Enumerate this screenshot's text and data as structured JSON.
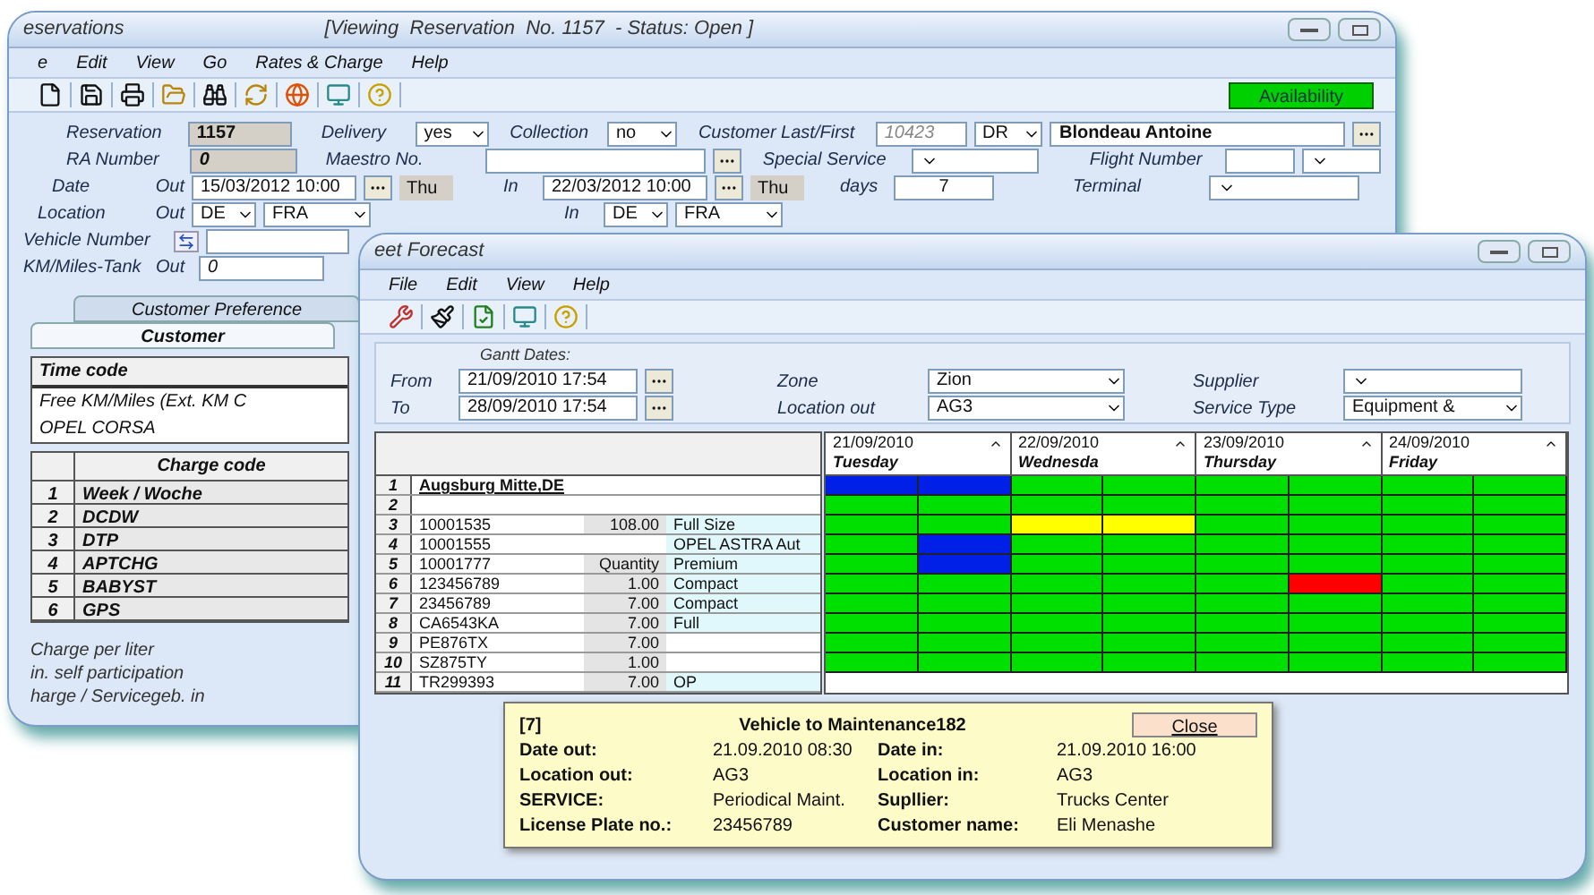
{
  "reservation_window": {
    "title": "eservations",
    "status": "[Viewing  Reservation  No. 1157  - Status: Open ]",
    "menu": [
      "e",
      "Edit",
      "View",
      "Go",
      "Rates & Charge",
      "Help"
    ],
    "availability_button": "Availability",
    "form": {
      "reservation": {
        "label": "Reservation",
        "value": "1157"
      },
      "delivery": {
        "label": "Delivery",
        "value": "yes"
      },
      "collection": {
        "label": "Collection",
        "value": "no"
      },
      "customer": {
        "label": "Customer Last/First",
        "id": "10423",
        "title": "DR",
        "name": "Blondeau Antoine"
      },
      "ra_number": {
        "label": "RA Number",
        "value": "0"
      },
      "maestro": {
        "label": "Maestro No."
      },
      "special_service": {
        "label": "Special Service"
      },
      "flight_number": {
        "label": "Flight Number"
      },
      "date": {
        "label": "Date",
        "out_label": "Out",
        "out_value": "15/03/2012 10:00",
        "out_day": "Thu",
        "in_label": "In",
        "in_value": "22/03/2012 10:00",
        "in_day": "Thu",
        "days_label": "days",
        "days_value": "7"
      },
      "terminal": {
        "label": "Terminal"
      },
      "location": {
        "label": "Location",
        "out_label": "Out",
        "out_country": "DE",
        "out_station": "FRA",
        "in_label": "In",
        "in_country": "DE",
        "in_station": "FRA"
      },
      "vehicle_number": {
        "label": "Vehicle Number"
      },
      "km_tank": {
        "label": "KM/Miles-Tank",
        "out_label": "Out",
        "out_value": "0"
      }
    },
    "tabs": [
      {
        "label": "Customer Preference",
        "selected": false
      },
      {
        "label": "Customer",
        "selected": true
      }
    ],
    "time_code_table": {
      "header": "Time code",
      "rows": [
        "Free KM/Miles (Ext. KM C",
        "OPEL CORSA"
      ]
    },
    "charge_code_table": {
      "header": "Charge code",
      "rows": [
        {
          "no": "1",
          "code": "Week / Woche"
        },
        {
          "no": "2",
          "code": "DCDW"
        },
        {
          "no": "3",
          "code": "DTP"
        },
        {
          "no": "4",
          "code": "APTCHG"
        },
        {
          "no": "5",
          "code": "BABYST"
        },
        {
          "no": "6",
          "code": "GPS"
        }
      ]
    },
    "footer_labels": [
      "Charge per liter",
      "in. self participation",
      "harge / Servicegeb. in"
    ]
  },
  "forecast_window": {
    "title": "eet Forecast",
    "menu": [
      "File",
      "Edit",
      "View",
      "Help"
    ],
    "filters": {
      "gantt_dates_label": "Gantt Dates:",
      "from": {
        "label": "From",
        "value": "21/09/2010 17:54"
      },
      "to": {
        "label": "To",
        "value": "28/09/2010 17:54"
      },
      "zone": {
        "label": "Zone",
        "value": "Zion"
      },
      "location_out": {
        "label": "Location out",
        "value": "AG3"
      },
      "supplier": {
        "label": "Supplier"
      },
      "service_type": {
        "label": "Service Type",
        "value": "Equipment &"
      }
    },
    "vehicle_table": {
      "rows": [
        {
          "no": "1",
          "column_1": "Augsburg Mitte,DE"
        },
        {
          "no": "2"
        },
        {
          "no": "3",
          "column_1": "10001535",
          "column_2": "108.00",
          "column_3": "Full Size"
        },
        {
          "no": "4",
          "column_1": "10001555",
          "column_3": "OPEL ASTRA Aut"
        },
        {
          "no": "5",
          "column_1": "10001777",
          "column_2": "Quantity",
          "column_3": "Premium"
        },
        {
          "no": "6",
          "column_1": "123456789",
          "column_2": "1.00",
          "column_3": "Compact"
        },
        {
          "no": "7",
          "column_1": "23456789",
          "column_2": "7.00",
          "column_3": "Compact"
        },
        {
          "no": "8",
          "column_1": "CA6543KA",
          "column_2": "7.00",
          "column_3": "Full"
        },
        {
          "no": "9",
          "column_1": "PE876TX",
          "column_2": "7.00"
        },
        {
          "no": "10",
          "column_1": "SZ875TY",
          "column_2": "1.00"
        },
        {
          "no": "11",
          "column_1": "TR299393",
          "column_2": "7.00",
          "column_3": "OP"
        }
      ]
    },
    "gantt": {
      "days": [
        {
          "date": "21/09/2010",
          "weekday": "Tuesday"
        },
        {
          "date": "22/09/2010",
          "weekday": "Wednesda"
        },
        {
          "date": "23/09/2010",
          "weekday": "Thursday"
        },
        {
          "date": "24/09/2010",
          "weekday": "Friday"
        }
      ],
      "rows": [
        {
          "cells": [
            {
              "color": "#0020e8"
            },
            {
              "color": "#0020e8"
            },
            {
              "color": "#00e000"
            },
            {
              "color": "#00e000"
            },
            {
              "color": "#00e000"
            },
            {
              "color": "#00e000"
            },
            {
              "color": "#00e000"
            },
            {
              "color": "#00e000"
            }
          ]
        },
        {
          "cells": [
            {
              "color": "#00e000"
            },
            {
              "color": "#00e000"
            },
            {
              "color": "#00e000"
            },
            {
              "color": "#00e000"
            },
            {
              "color": "#00e000"
            },
            {
              "color": "#00e000"
            },
            {
              "color": "#00e000"
            },
            {
              "color": "#00e000"
            }
          ]
        },
        {
          "cells": [
            {
              "color": "#00e000"
            },
            {
              "color": "#00e000"
            },
            {
              "color": "#ffff00"
            },
            {
              "color": "#ffff00"
            },
            {
              "color": "#00e000"
            },
            {
              "color": "#00e000"
            },
            {
              "color": "#00e000"
            },
            {
              "color": "#00e000"
            }
          ]
        },
        {
          "cells": [
            {
              "color": "#00e000"
            },
            {
              "color": "#0020e8"
            },
            {
              "color": "#00e000"
            },
            {
              "color": "#00e000"
            },
            {
              "color": "#00e000"
            },
            {
              "color": "#00e000"
            },
            {
              "color": "#00e000"
            },
            {
              "color": "#00e000"
            }
          ]
        },
        {
          "cells": [
            {
              "color": "#00e000"
            },
            {
              "color": "#0020e8"
            },
            {
              "color": "#00e000"
            },
            {
              "color": "#00e000"
            },
            {
              "color": "#00e000"
            },
            {
              "color": "#00e000"
            },
            {
              "color": "#00e000"
            },
            {
              "color": "#00e000"
            }
          ]
        },
        {
          "cells": [
            {
              "color": "#00e000"
            },
            {
              "color": "#00e000"
            },
            {
              "color": "#00e000"
            },
            {
              "color": "#00e000"
            },
            {
              "color": "#00e000"
            },
            {
              "color": "#ff0000"
            },
            {
              "color": "#00e000"
            },
            {
              "color": "#00e000"
            }
          ]
        },
        {
          "cells": [
            {
              "color": "#00e000"
            },
            {
              "color": "#00e000"
            },
            {
              "color": "#00e000"
            },
            {
              "color": "#00e000"
            },
            {
              "color": "#00e000"
            },
            {
              "color": "#00e000"
            },
            {
              "color": "#00e000"
            },
            {
              "color": "#00e000"
            }
          ]
        },
        {
          "cells": [
            {
              "color": "#00e000"
            },
            {
              "color": "#00e000"
            },
            {
              "color": "#00e000"
            },
            {
              "color": "#00e000"
            },
            {
              "color": "#00e000"
            },
            {
              "color": "#00e000"
            },
            {
              "color": "#00e000"
            },
            {
              "color": "#00e000"
            }
          ]
        },
        {
          "cells": [
            {
              "color": "#00e000"
            },
            {
              "color": "#00e000"
            },
            {
              "color": "#00e000"
            },
            {
              "color": "#00e000"
            },
            {
              "color": "#00e000"
            },
            {
              "color": "#00e000"
            },
            {
              "color": "#00e000"
            },
            {
              "color": "#00e000"
            }
          ]
        },
        {
          "cells": [
            {
              "color": "#00e000"
            },
            {
              "color": "#00e000"
            },
            {
              "color": "#00e000"
            },
            {
              "color": "#00e000"
            },
            {
              "color": "#00e000"
            },
            {
              "color": "#00e000"
            },
            {
              "color": "#00e000"
            },
            {
              "color": "#00e000"
            }
          ]
        }
      ]
    },
    "popup": {
      "index": "[7]",
      "title": "Vehicle to Maintenance182",
      "close_button": "Close",
      "fields": [
        {
          "label": "Date out:",
          "value": "21.09.2010 08:30"
        },
        {
          "label": "Date in:",
          "value": "21.09.2010 16:00"
        },
        {
          "label": "Location out:",
          "value": "AG3"
        },
        {
          "label": "Location in:",
          "value": "AG3"
        },
        {
          "label": "SERVICE:",
          "value": "Periodical Maint."
        },
        {
          "label": "Supllier:",
          "value": "Trucks Center"
        },
        {
          "label": "License Plate no.:",
          "value": "23456789"
        },
        {
          "label": "Customer name:",
          "value": "Eli Menashe"
        }
      ]
    }
  }
}
